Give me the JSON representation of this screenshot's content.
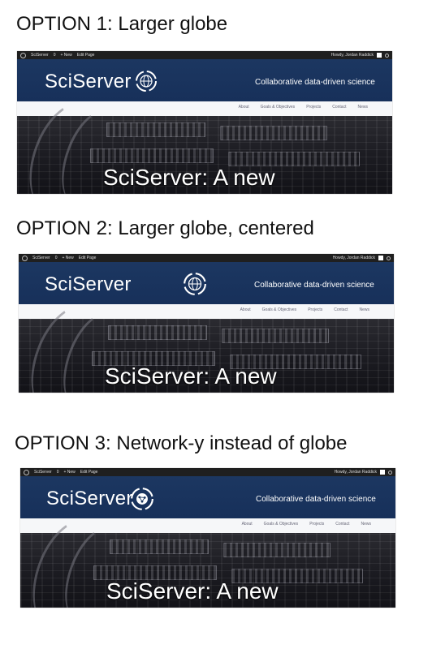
{
  "options": [
    {
      "title": "OPTION 1: Larger globe",
      "variant": "globe"
    },
    {
      "title": "OPTION 2: Larger globe, centered",
      "variant": "globe-centered"
    },
    {
      "title": "OPTION 3: Network-y instead of globe",
      "variant": "network"
    }
  ],
  "adminbar": {
    "site": "SciServer",
    "comments": "0",
    "new": "+ New",
    "edit": "Edit Page",
    "greeting": "Howdy, Jordan Raddick"
  },
  "site": {
    "logo_text": "SciServer",
    "tagline": "Collaborative data-driven science",
    "nav": [
      "About",
      "Goals & Objectives",
      "Projects",
      "Contact",
      "News"
    ],
    "hero_title": "SciServer: A new"
  },
  "colors": {
    "header": "#1c3761",
    "adminbar": "#1f1f1f",
    "navbar": "#f6f7f9"
  }
}
